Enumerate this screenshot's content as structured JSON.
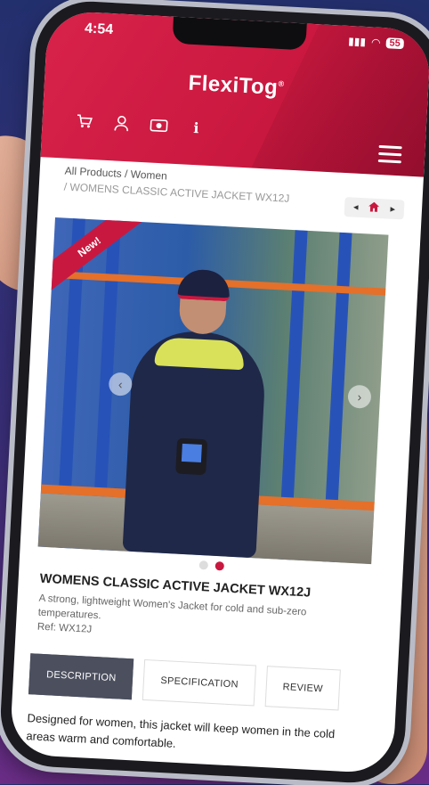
{
  "status_bar": {
    "time": "4:54",
    "battery": "55"
  },
  "header": {
    "logo": "FlexiTog",
    "logo_mark": "®"
  },
  "breadcrumb": {
    "all_products": "All Products",
    "separator": "/",
    "category": "Women",
    "current": "WOMENS CLASSIC ACTIVE JACKET WX12J"
  },
  "nav": {
    "prev": "◂",
    "next": "▸"
  },
  "hero": {
    "badge": "New!"
  },
  "product": {
    "name": "WOMENS CLASSIC ACTIVE JACKET WX12J",
    "summary": "A strong, lightweight Women's Jacket for cold and sub-zero temperatures.",
    "ref": "Ref: WX12J"
  },
  "tabs": [
    "DESCRIPTION",
    "SPECIFICATION",
    "REVIEW"
  ],
  "description": "Designed for women, this jacket will keep women in the cold areas warm and comfortable.",
  "colors": {
    "brand": "#c9183f",
    "active_tab": "#4b4f5e"
  },
  "icons": [
    "cart-icon",
    "user-icon",
    "currency-icon",
    "info-icon",
    "home-icon",
    "menu-icon"
  ]
}
